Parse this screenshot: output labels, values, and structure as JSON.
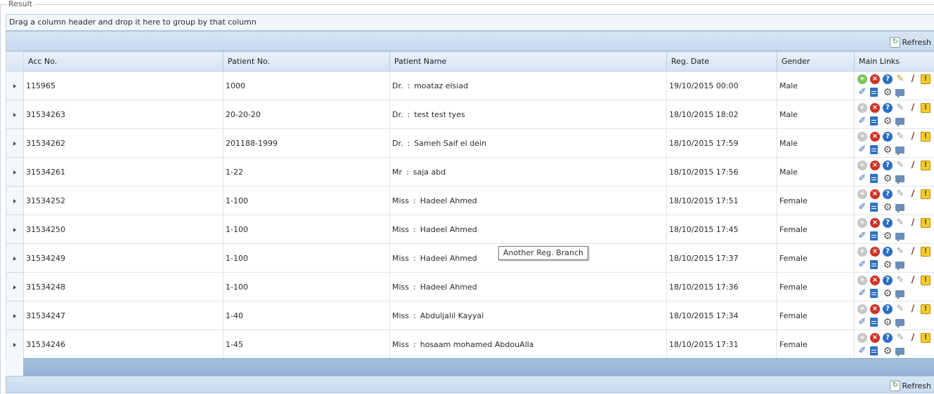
{
  "panel": {
    "legend": "Result"
  },
  "group_panel": {
    "text": "Drag a column header and drop it here to group by that column"
  },
  "toolbar": {
    "refresh_label": "Refresh"
  },
  "columns": [
    "Acc No.",
    "Patient No.",
    "Patient Name",
    "Reg. Date",
    "Gender",
    "Main Links"
  ],
  "rows": [
    {
      "acc": "115965",
      "patient_no": "1000",
      "title": "Dr.",
      "name": "moataz elsiad",
      "reg_date": "19/10/2015 00:00",
      "gender": "Male"
    },
    {
      "acc": "31534263",
      "patient_no": "20-20-20",
      "title": "Dr.",
      "name": "test test tyes",
      "reg_date": "18/10/2015 18:02",
      "gender": "Male"
    },
    {
      "acc": "31534262",
      "patient_no": "201188-1999",
      "title": "Dr.",
      "name": "Sameh Saif el dein",
      "reg_date": "18/10/2015 17:59",
      "gender": "Male"
    },
    {
      "acc": "31534261",
      "patient_no": "1-22",
      "title": "Mr",
      "name": "saja abd",
      "reg_date": "18/10/2015 17:56",
      "gender": "Male"
    },
    {
      "acc": "31534252",
      "patient_no": "1-100",
      "title": "Miss",
      "name": "Hadeel Ahmed",
      "reg_date": "18/10/2015 17:51",
      "gender": "Female"
    },
    {
      "acc": "31534250",
      "patient_no": "1-100",
      "title": "Miss",
      "name": "Hadeel Ahmed",
      "reg_date": "18/10/2015 17:45",
      "gender": "Female"
    },
    {
      "acc": "31534249",
      "patient_no": "1-100",
      "title": "Miss",
      "name": "Hadeel Ahmed",
      "reg_date": "18/10/2015 17:37",
      "gender": "Female"
    },
    {
      "acc": "31534248",
      "patient_no": "1-100",
      "title": "Miss",
      "name": "Hadeel Ahmed",
      "reg_date": "18/10/2015 17:36",
      "gender": "Female"
    },
    {
      "acc": "31534247",
      "patient_no": "1-40",
      "title": "Miss",
      "name": "Abduljalil Kayyal",
      "reg_date": "18/10/2015 17:34",
      "gender": "Female"
    },
    {
      "acc": "31534246",
      "patient_no": "1-45",
      "title": "Miss",
      "name": "hosaam mohamed AbdouAlla",
      "reg_date": "18/10/2015 17:31",
      "gender": "Female"
    }
  ],
  "name_separator": ":",
  "main_links_icons": [
    "add-icon",
    "delete-icon",
    "help-icon",
    "edit-icon",
    "brush-icon",
    "warning-icon",
    "attachment-icon",
    "document-icon",
    "settings-icon",
    "comment-icon"
  ],
  "first_row_add_enabled": true,
  "tooltip": {
    "text": "Another Reg. Branch"
  },
  "colors": {
    "header_bg": "#d4e3f3",
    "pager_bg": "#8fb0d4",
    "toolbar_bg": "#c9dbee"
  }
}
